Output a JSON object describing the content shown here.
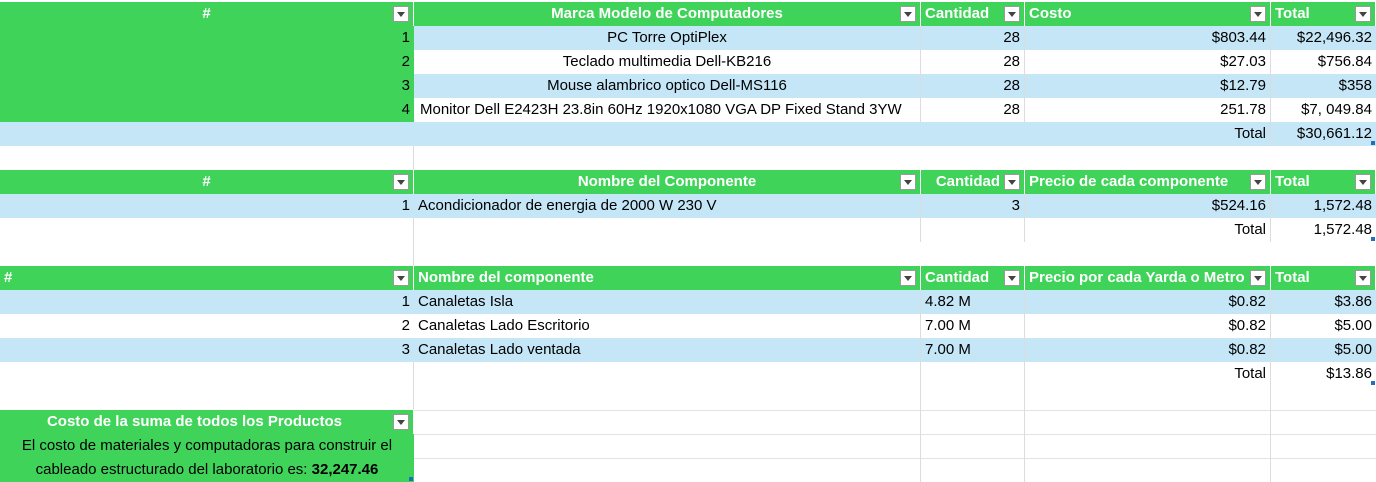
{
  "table1": {
    "headers": [
      "#",
      "Marca Modelo de Computadores",
      "Cantidad",
      "Costo",
      "Total"
    ],
    "rows": [
      {
        "n": "1",
        "item": "PC Torre OptiPlex",
        "qty": "28",
        "cost": "$803.44",
        "total": "$22,496.32"
      },
      {
        "n": "2",
        "item": "Teclado multimedia Dell-KB216",
        "qty": "28",
        "cost": "$27.03",
        "total": "$756.84"
      },
      {
        "n": "3",
        "item": "Mouse alambrico optico Dell-MS116",
        "qty": "28",
        "cost": "$12.79",
        "total": "$358"
      },
      {
        "n": "4",
        "item": "Monitor Dell E2423H 23.8in 60Hz 1920x1080 VGA DP Fixed Stand 3YW",
        "qty": "28",
        "cost": "251.78",
        "total": "$7, 049.84"
      }
    ],
    "total_label": "Total",
    "total_value": "$30,661.12"
  },
  "table2": {
    "headers": [
      "#",
      "Nombre del Componente",
      "Cantidad",
      "Precio de cada componente",
      "Total"
    ],
    "rows": [
      {
        "n": "1",
        "item": "Acondicionador de energia de 2000 W 230 V",
        "qty": "3",
        "cost": "$524.16",
        "total": "1,572.48"
      }
    ],
    "total_label": "Total",
    "total_value": "1,572.48"
  },
  "table3": {
    "headers": [
      "#",
      "Nombre del componente",
      "Cantidad",
      "Precio por cada Yarda o Metro",
      "Total"
    ],
    "rows": [
      {
        "n": "1",
        "item": "Canaletas Isla",
        "qty": "4.82 M",
        "cost": "$0.82",
        "total": "$3.86"
      },
      {
        "n": "2",
        "item": "Canaletas Lado Escritorio",
        "qty": "7.00 M",
        "cost": "$0.82",
        "total": "$5.00"
      },
      {
        "n": "3",
        "item": "Canaletas Lado ventada",
        "qty": "7.00 M",
        "cost": "$0.82",
        "total": "$5.00"
      }
    ],
    "total_label": "Total",
    "total_value": "$13.86"
  },
  "summary": {
    "header": "Costo de la suma de todos los Productos",
    "line1": "El costo de materiales y computadoras para construir el",
    "line2_prefix": "cableado estructurado del laboratorio es: ",
    "line2_value": "32,247.46"
  },
  "colors": {
    "header_green": "#40d35a",
    "band_blue": "#c4e6f7"
  }
}
